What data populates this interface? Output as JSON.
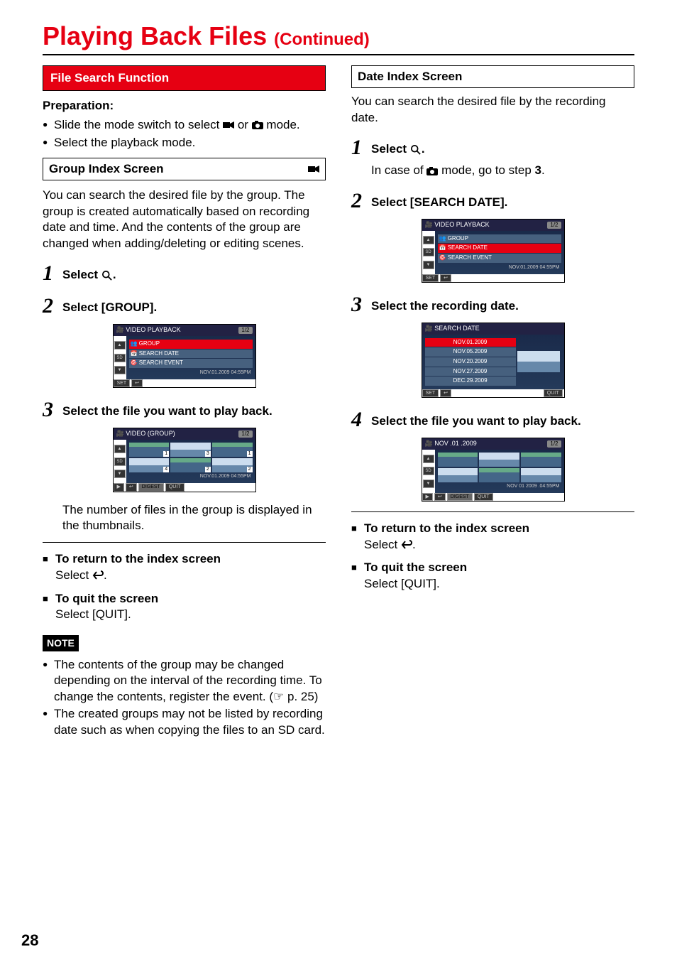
{
  "page": {
    "title_main": "Playing Back Files",
    "title_cont": "(Continued)",
    "page_number": "28"
  },
  "left": {
    "section_header": "File Search Function",
    "preparation_label": "Preparation:",
    "prep_item1_a": "Slide the mode switch to select ",
    "prep_item1_b": " or ",
    "prep_item1_c": " mode.",
    "prep_item2": "Select the playback mode.",
    "group_header": "Group Index Screen",
    "group_desc": "You can search the desired file by the group. The group is created automatically based on recording date and time. And the contents of the group are changed when adding/deleting or editing scenes.",
    "step1_label": "Select ",
    "step1_suffix": ".",
    "step2_label": "Select [GROUP].",
    "step3_label": "Select the file you want to play back.",
    "step3_follow": "The number of files in the group is displayed in the thumbnails.",
    "return_title": "To return to the index screen",
    "return_body_a": "Select ",
    "return_body_b": ".",
    "quit_title": "To quit the screen",
    "quit_body": "Select [QUIT].",
    "note_label": "NOTE",
    "note1": "The contents of the group may be changed depending on the interval of the recording time. To change the contents, register the event. (☞ p. 25)",
    "note2": "The created groups may not be listed by recording date such as when copying the files to an SD card.",
    "menu1": {
      "title": "VIDEO PLAYBACK",
      "page": "1/2",
      "item_group": "GROUP",
      "item_search_date": "SEARCH DATE",
      "item_search_event": "SEARCH EVENT",
      "timestamp": "NOV.01.2009 04:55PM",
      "btn_set": "SET",
      "side_sd": "SD"
    },
    "menu2": {
      "title": "VIDEO (GROUP)",
      "page": "1/2",
      "n1": "1",
      "n2": "3",
      "n3": "1",
      "n4": "4",
      "n5": "2",
      "n6": "2",
      "timestamp": "NOV.01.2009 04:55PM",
      "btn_play": "▶",
      "btn_digest": "DIGEST",
      "btn_quit": "QUIT",
      "side_sd": "SD"
    }
  },
  "right": {
    "section_header": "Date Index Screen",
    "desc": "You can search the desired file by the recording date.",
    "step1_label": "Select ",
    "step1_suffix": ".",
    "step1_follow_a": "In case of ",
    "step1_follow_b": " mode, go to step ",
    "step1_follow_c": "3",
    "step1_follow_d": ".",
    "step2_label": "Select [SEARCH DATE].",
    "step3_label": "Select the recording date.",
    "step4_label": "Select the file you want to play back.",
    "return_title": "To return to the index screen",
    "return_body_a": "Select ",
    "return_body_b": ".",
    "quit_title": "To quit the screen",
    "quit_body": "Select [QUIT].",
    "menu1": {
      "title": "VIDEO PLAYBACK",
      "page": "1/2",
      "item_group": "GROUP",
      "item_search_date": "SEARCH DATE",
      "item_search_event": "SEARCH EVENT",
      "timestamp": "NOV.01.2009 04:55PM",
      "btn_set": "SET",
      "side_sd": "SD"
    },
    "menu2": {
      "title": "SEARCH DATE",
      "d1": "NOV.01.2009",
      "d2": "NOV.05.2009",
      "d3": "NOV.20.2009",
      "d4": "NOV.27.2009",
      "d5": "DEC.29.2009",
      "btn_set": "SET",
      "btn_quit": "QUIT"
    },
    "menu3": {
      "title": "NOV .01 .2009",
      "page": "1/2",
      "timestamp": "NOV  01  2009 .04:55PM",
      "btn_play": "▶",
      "btn_digest": "DIGEST",
      "btn_quit": "QUIT",
      "side_sd": "SD"
    }
  }
}
